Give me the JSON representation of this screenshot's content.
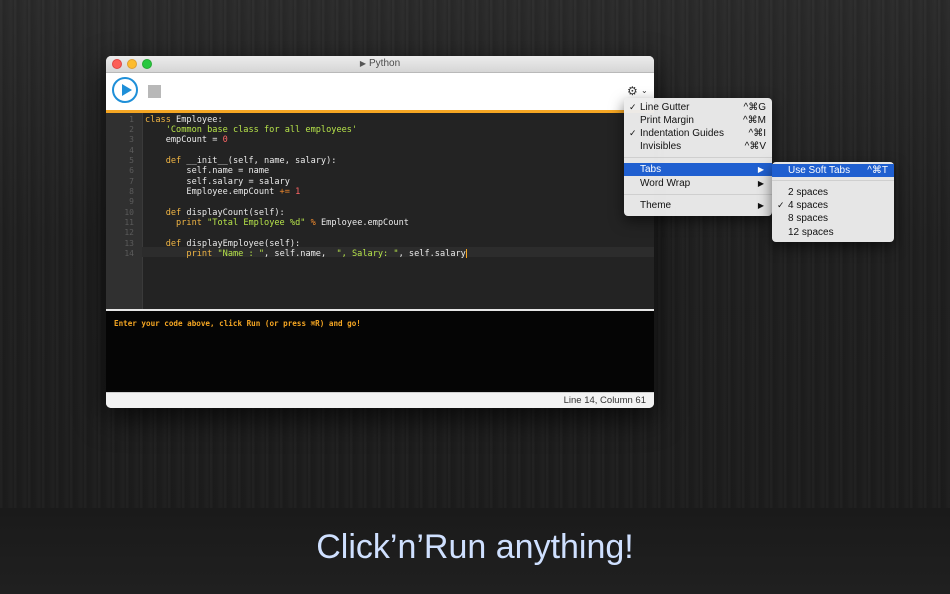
{
  "window": {
    "title": "Python",
    "status": "Line 14, Column 61",
    "console_text": "Enter your code above, click Run (or press ⌘R) and go!"
  },
  "toolbar": {
    "run_icon": "play-circle-icon",
    "stop_icon": "stop-square-icon",
    "settings_icon": "gear-icon"
  },
  "editor": {
    "line_numbers": [
      "1",
      "2",
      "3",
      "4",
      "5",
      "6",
      "7",
      "8",
      "9",
      "10",
      "11",
      "12",
      "13",
      "14"
    ],
    "lines": [
      "class Employee:",
      "    'Common base class for all employees'",
      "    empCount = 0",
      "",
      "    def __init__(self, name, salary):",
      "        self.name = name",
      "        self.salary = salary",
      "        Employee.empCount += 1",
      "",
      "    def displayCount(self):",
      "      print \"Total Employee %d\" % Employee.empCount",
      "",
      "    def displayEmployee(self):",
      "        print \"Name : \", self.name,  \", Salary: \", self.salary"
    ]
  },
  "menu": {
    "items": [
      {
        "label": "Line Gutter",
        "shortcut": "^⌘G",
        "checked": true
      },
      {
        "label": "Print Margin",
        "shortcut": "^⌘M",
        "checked": false
      },
      {
        "label": "Indentation Guides",
        "shortcut": "^⌘I",
        "checked": true
      },
      {
        "label": "Invisibles",
        "shortcut": "^⌘V",
        "checked": false
      },
      {
        "label": "Tabs",
        "submenu": true,
        "highlighted": true
      },
      {
        "label": "Word Wrap",
        "submenu": true
      },
      {
        "label": "Theme",
        "submenu": true
      }
    ],
    "check_mark": "✓",
    "submenu_arrow": "▶"
  },
  "submenu": {
    "items": [
      {
        "label": "Use Soft Tabs",
        "shortcut": "^⌘T",
        "highlighted": true
      },
      {
        "label": "2 spaces",
        "checked": false
      },
      {
        "label": "4 spaces",
        "checked": true
      },
      {
        "label": "8 spaces",
        "checked": false
      },
      {
        "label": "12 spaces",
        "checked": false
      }
    ]
  },
  "caption": "Click’n’Run anything!",
  "colors": {
    "accent": "#1e8fd8",
    "orange": "#f5a623",
    "highlight": "#1f5fd0"
  }
}
